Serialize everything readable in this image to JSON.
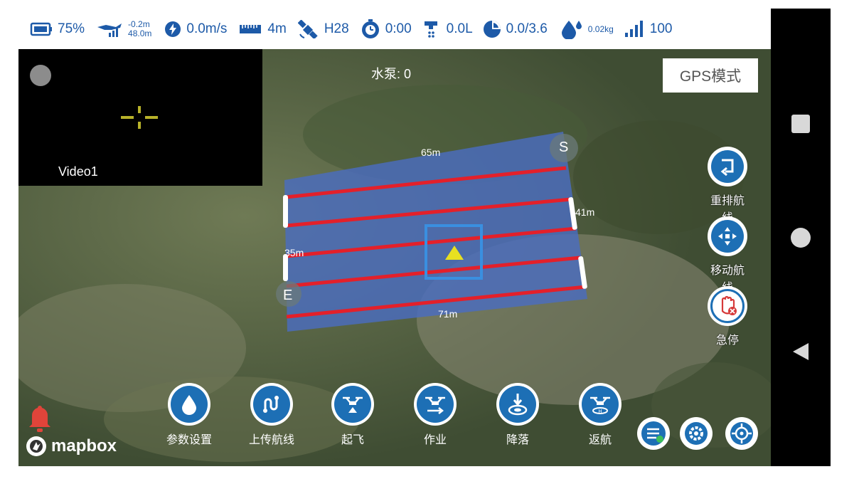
{
  "status_bar": {
    "battery": "75%",
    "altitude_delta": "-0.2m",
    "altitude": "48.0m",
    "speed": "0.0m/s",
    "distance": "4m",
    "satellite": "H28",
    "timer": "0:00",
    "flow": "0.0L",
    "area": "0.0/3.6",
    "weight": "0.02kg",
    "signal": "100"
  },
  "video": {
    "label": "Video1"
  },
  "pump": {
    "label": "水泵: 0"
  },
  "mode": {
    "label": "GPS模式"
  },
  "field": {
    "top_edge": "65m",
    "right_edge": "41m",
    "left_edge": "35m",
    "bottom_edge": "71m",
    "start_marker": "S",
    "end_marker": "E"
  },
  "side_actions": {
    "rearrange": "重排航线",
    "move": "移动航线",
    "emergency_stop": "急停"
  },
  "bottom_actions": {
    "params": "参数设置",
    "upload": "上传航线",
    "takeoff": "起飞",
    "work": "作业",
    "land": "降落",
    "return": "返航"
  },
  "brand": {
    "name": "mapbox"
  },
  "colors": {
    "accent": "#1d6fb5",
    "route": "#e3202a",
    "field": "#4a6cc0",
    "stop": "#d63a3a"
  },
  "icons": [
    "battery-icon",
    "drone-altitude-icon",
    "speed-icon",
    "ruler-icon",
    "satellite-icon",
    "timer-icon",
    "spray-icon",
    "pie-icon",
    "drop-icon",
    "signal-icon",
    "gear-icon",
    "target-icon",
    "bell-icon"
  ]
}
